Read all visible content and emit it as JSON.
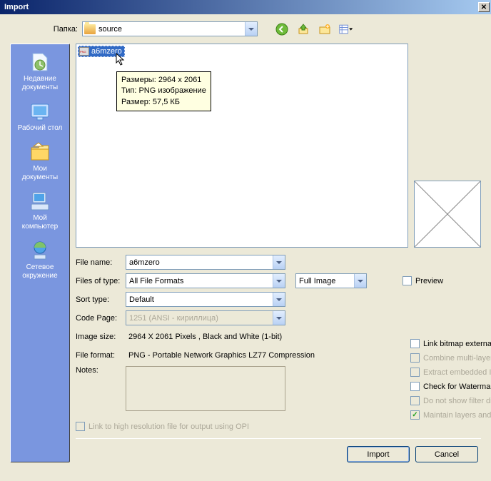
{
  "title": "Import",
  "folder": {
    "label": "Папка:",
    "value": "source"
  },
  "sidebar": [
    {
      "label": "Недавние\nдокументы"
    },
    {
      "label": "Рабочий стол"
    },
    {
      "label": "Мои\nдокументы"
    },
    {
      "label": "Мой\nкомпьютер"
    },
    {
      "label": "Сетевое\nокружение"
    }
  ],
  "file": {
    "name": "a6mzero"
  },
  "tooltip": {
    "l1": "Размеры: 2964 x 2061",
    "l2": "Тип: PNG изображение",
    "l3": "Размер: 57,5 КБ"
  },
  "form": {
    "filename_label": "File name:",
    "filename_value": "a6mzero",
    "filetype_label": "Files of type:",
    "filetype_value": "All File Formats",
    "fullimage": "Full Image",
    "preview": "Preview",
    "sort_label": "Sort type:",
    "sort_value": "Default",
    "codepage_label": "Code Page:",
    "codepage_value": "1251  (ANSI - кириллица)",
    "imagesize_label": "Image size:",
    "imagesize_value": "2964 X 2061 Pixels , Black and White (1-bit)",
    "fileformat_label": "File format:",
    "fileformat_value": "PNG - Portable Network Graphics LZ77 Compression",
    "notes_label": "Notes:"
  },
  "options": {
    "link_bitmap": "Link bitmap externally",
    "combine": "Combine multi-layer bitmap",
    "extract_icc": "Extract embedded ICC profile",
    "watermark": "Check for Watermark",
    "no_filter": "Do not show filter dialog",
    "maintain": "Maintain layers and pages"
  },
  "opi": "Link to high resolution file for output using OPI",
  "buttons": {
    "import": "Import",
    "cancel": "Cancel"
  }
}
